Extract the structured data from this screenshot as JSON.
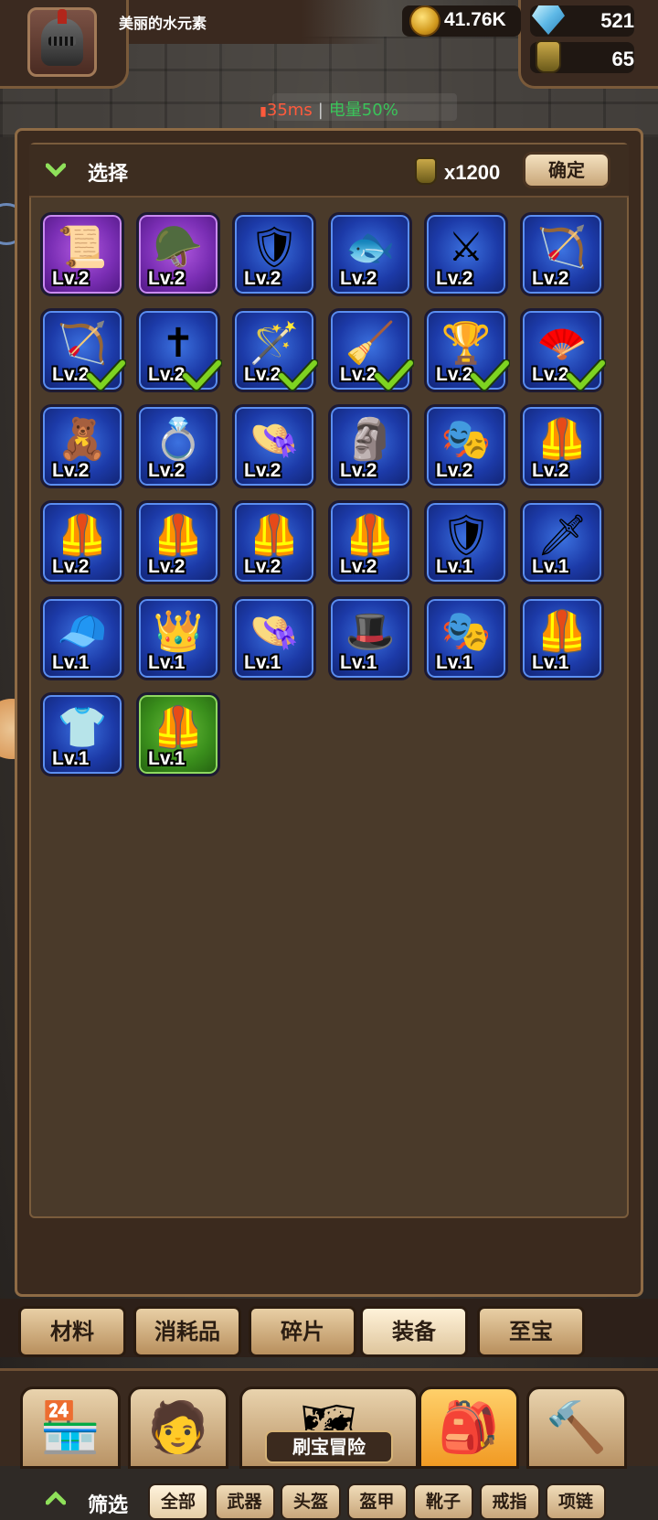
{
  "player": {
    "name": "美丽的水元素"
  },
  "resources": {
    "gold": "41.76K",
    "gems": "521",
    "potions": "65"
  },
  "status": {
    "ping": "35ms",
    "battery": "电量50%"
  },
  "select": {
    "title": "选择",
    "cost": "x1200",
    "confirm": "确定"
  },
  "items": [
    {
      "lv": "Lv.2",
      "rarity": "purple",
      "icon": "scroll-icon",
      "glyph": "📜",
      "checked": false
    },
    {
      "lv": "Lv.2",
      "rarity": "purple",
      "icon": "dark-helmet-icon",
      "glyph": "🪖",
      "checked": false
    },
    {
      "lv": "Lv.2",
      "rarity": "blue",
      "icon": "round-shield-icon",
      "glyph": "🛡",
      "checked": false
    },
    {
      "lv": "Lv.2",
      "rarity": "blue",
      "icon": "swordfish-icon",
      "glyph": "🐟",
      "checked": false
    },
    {
      "lv": "Lv.2",
      "rarity": "blue",
      "icon": "light-saber-icon",
      "glyph": "⚔",
      "checked": false
    },
    {
      "lv": "Lv.2",
      "rarity": "blue",
      "icon": "crossbow-icon",
      "glyph": "🏹",
      "checked": false
    },
    {
      "lv": "Lv.2",
      "rarity": "blue",
      "icon": "wooden-bow-icon",
      "glyph": "🏹",
      "checked": true
    },
    {
      "lv": "Lv.2",
      "rarity": "blue",
      "icon": "cross-bow-icon",
      "glyph": "✝",
      "checked": true
    },
    {
      "lv": "Lv.2",
      "rarity": "blue",
      "icon": "star-wand-icon",
      "glyph": "🪄",
      "checked": true
    },
    {
      "lv": "Lv.2",
      "rarity": "blue",
      "icon": "broom-icon",
      "glyph": "🧹",
      "checked": true
    },
    {
      "lv": "Lv.2",
      "rarity": "blue",
      "icon": "golden-chalice-icon",
      "glyph": "🏆",
      "checked": true
    },
    {
      "lv": "Lv.2",
      "rarity": "blue",
      "icon": "fan-staff-icon",
      "glyph": "🪭",
      "checked": true
    },
    {
      "lv": "Lv.2",
      "rarity": "blue",
      "icon": "gingerbread-icon",
      "glyph": "🧸",
      "checked": false
    },
    {
      "lv": "Lv.2",
      "rarity": "blue",
      "icon": "bronze-ring-icon",
      "glyph": "💍",
      "checked": false
    },
    {
      "lv": "Lv.2",
      "rarity": "blue",
      "icon": "straw-hat-icon",
      "glyph": "👒",
      "checked": false
    },
    {
      "lv": "Lv.2",
      "rarity": "blue",
      "icon": "wig-helmet-icon",
      "glyph": "🗿",
      "checked": false
    },
    {
      "lv": "Lv.2",
      "rarity": "blue",
      "icon": "mask-icon",
      "glyph": "🎭",
      "checked": false
    },
    {
      "lv": "Lv.2",
      "rarity": "blue",
      "icon": "lava-armor-icon",
      "glyph": "🦺",
      "checked": false
    },
    {
      "lv": "Lv.2",
      "rarity": "blue",
      "icon": "pink-armor-icon",
      "glyph": "🦺",
      "checked": false
    },
    {
      "lv": "Lv.2",
      "rarity": "blue",
      "icon": "plate-armor-icon",
      "glyph": "🦺",
      "checked": false
    },
    {
      "lv": "Lv.2",
      "rarity": "blue",
      "icon": "blue-armor-icon",
      "glyph": "🦺",
      "checked": false
    },
    {
      "lv": "Lv.2",
      "rarity": "blue",
      "icon": "spiked-armor-icon",
      "glyph": "🦺",
      "checked": false
    },
    {
      "lv": "Lv.1",
      "rarity": "blue",
      "icon": "round-shield-icon",
      "glyph": "🛡",
      "checked": false
    },
    {
      "lv": "Lv.1",
      "rarity": "blue",
      "icon": "sword-icon",
      "glyph": "🗡",
      "checked": false
    },
    {
      "lv": "Lv.1",
      "rarity": "blue",
      "icon": "white-cap-icon",
      "glyph": "🧢",
      "checked": false
    },
    {
      "lv": "Lv.1",
      "rarity": "blue",
      "icon": "tiara-icon",
      "glyph": "👑",
      "checked": false
    },
    {
      "lv": "Lv.1",
      "rarity": "blue",
      "icon": "straw-hat-icon",
      "glyph": "👒",
      "checked": false
    },
    {
      "lv": "Lv.1",
      "rarity": "blue",
      "icon": "witch-hat-icon",
      "glyph": "🎩",
      "checked": false
    },
    {
      "lv": "Lv.1",
      "rarity": "blue",
      "icon": "mask-icon",
      "glyph": "🎭",
      "checked": false
    },
    {
      "lv": "Lv.1",
      "rarity": "blue",
      "icon": "spiked-armor-icon",
      "glyph": "🦺",
      "checked": false
    },
    {
      "lv": "Lv.1",
      "rarity": "blue",
      "icon": "tunic-icon",
      "glyph": "👕",
      "checked": false
    },
    {
      "lv": "Lv.1",
      "rarity": "green",
      "icon": "gold-armor-icon",
      "glyph": "🦺",
      "checked": false
    }
  ],
  "filter": {
    "title": "筛选",
    "tabs": [
      "全部",
      "武器",
      "头盔",
      "盔甲",
      "靴子",
      "戒指",
      "项链"
    ],
    "active": 0
  },
  "categories": {
    "tabs": [
      "材料",
      "消耗品",
      "碎片",
      "装备",
      "至宝"
    ],
    "active": 3
  },
  "nav": {
    "adventure_label": "刷宝冒险",
    "buttons": [
      {
        "icon": "shop-icon",
        "glyph": "🏪"
      },
      {
        "icon": "hero-icon",
        "glyph": "🧑"
      },
      {
        "icon": "bag-icon",
        "glyph": "🎒"
      },
      {
        "icon": "forge-icon",
        "glyph": "🔨"
      }
    ]
  },
  "colors": {
    "check": "#7ed321",
    "ping": "#ff5a3c",
    "battery": "#3ac45a"
  }
}
